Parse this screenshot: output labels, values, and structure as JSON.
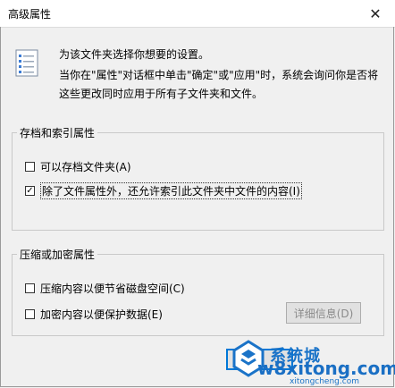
{
  "window": {
    "title": "高级属性",
    "close_glyph": "✕"
  },
  "intro": {
    "line1": "为该文件夹选择你想要的设置。",
    "line2": "当你在\"属性\"对话框中单击\"确定\"或\"应用\"时，系统会询问你是否将这些更改同时应用于所有子文件夹和文件。"
  },
  "archive_group": {
    "legend": "存档和索引属性",
    "items": [
      {
        "label": "可以存档文件夹(A)",
        "checked": false
      },
      {
        "label": "除了文件属性外，还允许索引此文件夹中文件的内容(I)",
        "checked": true
      }
    ]
  },
  "compress_group": {
    "legend": "压缩或加密属性",
    "items": [
      {
        "label": "压缩内容以便节省磁盘空间(C)",
        "checked": false
      },
      {
        "label": "加密内容以便保护数据(E)",
        "checked": false
      }
    ],
    "details_button": "详细信息(D)"
  },
  "watermark": {
    "top": "系统城",
    "main": "w8xitong.com",
    "sub": "xitongcheng.com"
  },
  "colors": {
    "accent": "#0078d7",
    "watermark": "#1a73c8"
  }
}
